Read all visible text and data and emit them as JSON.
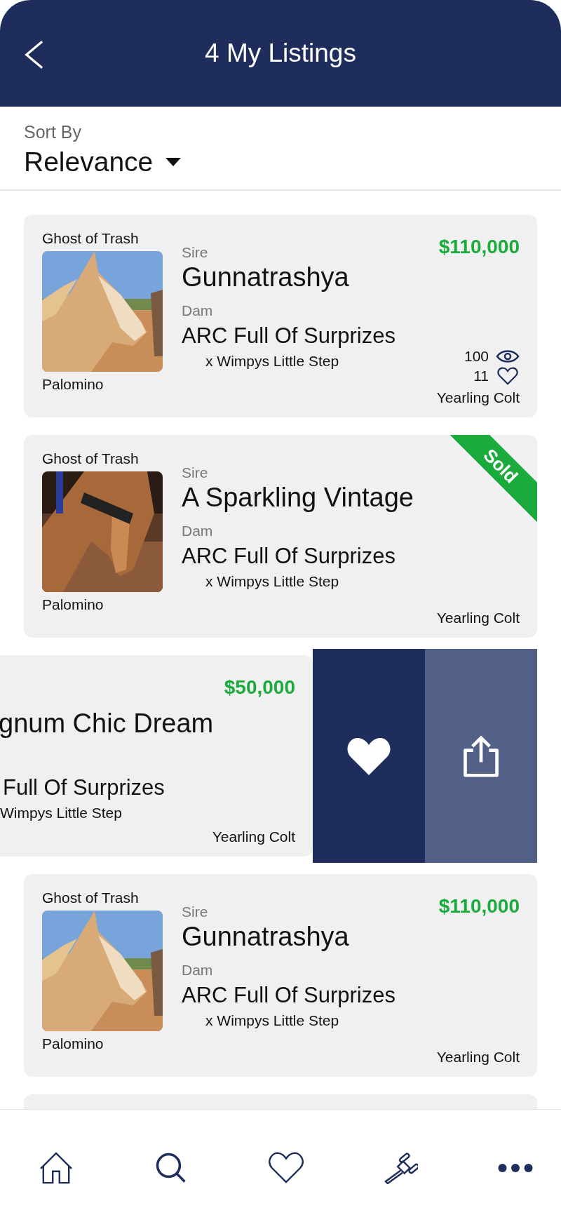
{
  "header": {
    "title": "4 My Listings"
  },
  "sort": {
    "label": "Sort By",
    "value": "Relevance"
  },
  "listings": [
    {
      "kind": "card",
      "owner": "Ghost of Trash",
      "sire_label": "Sire",
      "sire": "Gunnatrashya",
      "dam_label": "Dam",
      "dam": "ARC Full Of Surprizes",
      "dam_sire": "x Wimpys Little Step",
      "coat": "Palomino",
      "price": "$110,000",
      "views": "100",
      "likes": "11",
      "category": "Yearling Colt",
      "sold": false
    },
    {
      "kind": "card",
      "owner": "Ghost of Trash",
      "sire_label": "Sire",
      "sire": "A Sparkling Vintage",
      "dam_label": "Dam",
      "dam": "ARC Full Of Surprizes",
      "dam_sire": "x Wimpys Little Step",
      "coat": "Palomino",
      "category": "Yearling Colt",
      "sold": true,
      "sold_label": "Sold"
    },
    {
      "kind": "swiped",
      "sire": "gnum Chic Dream",
      "dam": "Full Of Surprizes",
      "dam_sire": "Wimpys Little Step",
      "price": "$50,000",
      "category": "Yearling Colt"
    },
    {
      "kind": "card",
      "owner": "Ghost of Trash",
      "sire_label": "Sire",
      "sire": "Gunnatrashya",
      "dam_label": "Dam",
      "dam": "ARC Full Of Surprizes",
      "dam_sire": "x Wimpys Little Step",
      "coat": "Palomino",
      "price": "$110,000",
      "category": "Yearling Colt",
      "sold": false
    },
    {
      "kind": "partial"
    }
  ],
  "nav": [
    {
      "kind": "home"
    },
    {
      "kind": "search"
    },
    {
      "kind": "favorites"
    },
    {
      "kind": "auctions"
    },
    {
      "kind": "more"
    }
  ]
}
